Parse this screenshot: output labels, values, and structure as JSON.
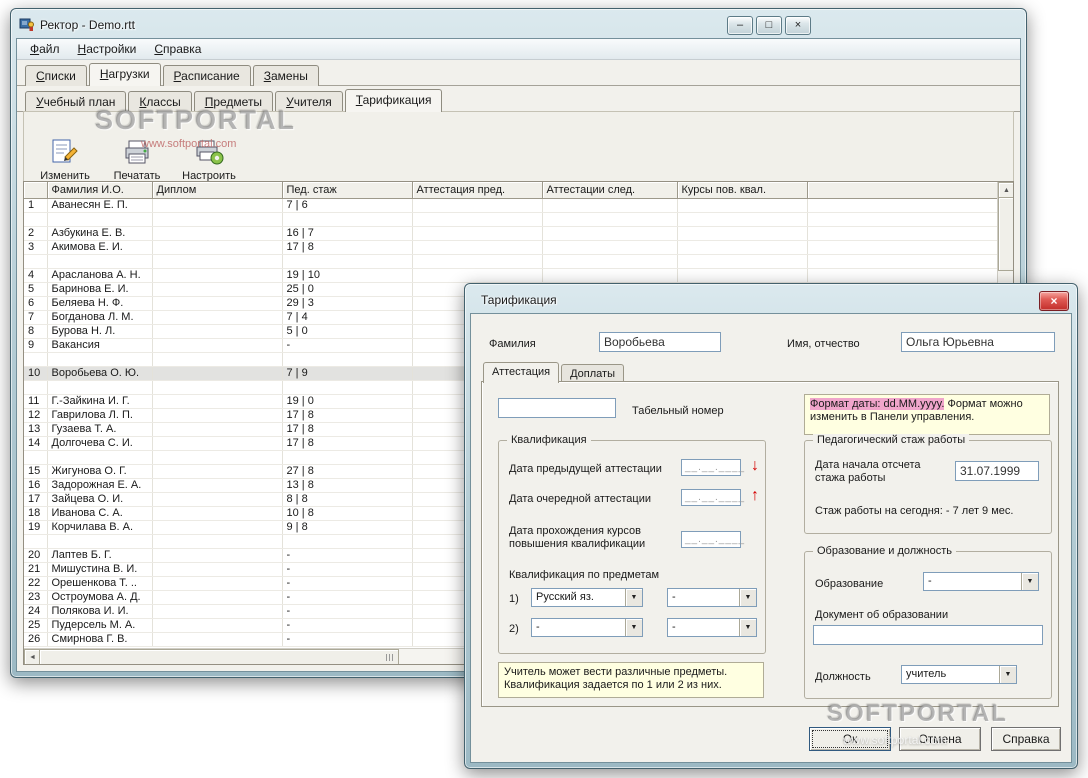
{
  "icons": {
    "minimize": "–",
    "maximize": "□",
    "close": "×",
    "arrow_up": "▲",
    "arrow_down": "▼",
    "arrow_left": "◄",
    "arrow_right": "►",
    "combo_arrow": "▼",
    "red_down_arrow": "↓",
    "red_up_arrow": "↑"
  },
  "main_window": {
    "title": "Ректор - Demo.rtt",
    "menu": [
      "Файл",
      "Настройки",
      "Справка"
    ],
    "main_tabs": {
      "items": [
        "Списки",
        "Нагрузки",
        "Расписание",
        "Замены"
      ],
      "active": 1
    },
    "sub_tabs": {
      "items": [
        "Учебный план",
        "Классы",
        "Предметы",
        "Учителя",
        "Тарификация"
      ],
      "active": 4
    },
    "toolbar": [
      {
        "id": "edit",
        "label": "Изменить"
      },
      {
        "id": "print",
        "label": "Печатать"
      },
      {
        "id": "configure",
        "label": "Настроить"
      }
    ],
    "watermark": {
      "big": "SOFTPORTAL",
      "small": "www.softportal.com"
    },
    "table": {
      "headers": [
        "Фамилия И.О.",
        "Диплом",
        "Пед. стаж",
        "Аттестация пред.",
        "Аттестации след.",
        "Курсы пов. квал."
      ],
      "rows": [
        {
          "n": "1",
          "name": "Аванесян Е. П.",
          "stazh": "7 | 6"
        },
        {
          "blank": true
        },
        {
          "n": "2",
          "name": "Азбукина Е. В.",
          "stazh": "16 | 7"
        },
        {
          "n": "3",
          "name": "Акимова Е. И.",
          "stazh": "17 | 8"
        },
        {
          "blank": true
        },
        {
          "n": "4",
          "name": "Арасланова А. Н.",
          "stazh": "19 | 10"
        },
        {
          "n": "5",
          "name": "Баринова Е. И.",
          "stazh": "25 | 0"
        },
        {
          "n": "6",
          "name": "Беляева Н. Ф.",
          "stazh": "29 | 3"
        },
        {
          "n": "7",
          "name": "Богданова Л. М.",
          "stazh": "7 | 4"
        },
        {
          "n": "8",
          "name": "Бурова Н. Л.",
          "stazh": "5 | 0"
        },
        {
          "n": "9",
          "name": "Вакансия",
          "stazh": "-"
        },
        {
          "blank": true
        },
        {
          "n": "10",
          "name": "Воробьева О. Ю.",
          "stazh": "7 | 9",
          "selected": true
        },
        {
          "blank": true
        },
        {
          "n": "11",
          "name": "Г.-Зайкина И. Г.",
          "stazh": "19 | 0"
        },
        {
          "n": "12",
          "name": "Гаврилова Л. П.",
          "stazh": "17 | 8"
        },
        {
          "n": "13",
          "name": "Гузаева Т. А.",
          "stazh": "17 | 8"
        },
        {
          "n": "14",
          "name": "Долгочева С. И.",
          "stazh": "17 | 8"
        },
        {
          "blank": true
        },
        {
          "n": "15",
          "name": "Жигунова О. Г.",
          "stazh": "27 | 8"
        },
        {
          "n": "16",
          "name": "Задорожная Е. А.",
          "stazh": "13 | 8"
        },
        {
          "n": "17",
          "name": "Зайцева О. И.",
          "stazh": "8 | 8"
        },
        {
          "n": "18",
          "name": "Иванова С. А.",
          "stazh": "10 | 8"
        },
        {
          "n": "19",
          "name": "Корчилава В. А.",
          "stazh": "9 | 8"
        },
        {
          "blank": true
        },
        {
          "n": "20",
          "name": "Лаптев Б. Г.",
          "stazh": "-"
        },
        {
          "n": "21",
          "name": "Мишустина В. И.",
          "stazh": "-"
        },
        {
          "n": "22",
          "name": "Орешенкова Т. ..",
          "stazh": "-"
        },
        {
          "n": "23",
          "name": "Остроумова А. Д.",
          "stazh": "-"
        },
        {
          "n": "24",
          "name": "Полякова И. И.",
          "stazh": "-"
        },
        {
          "n": "25",
          "name": "Пудерсель М. А.",
          "stazh": "-"
        },
        {
          "n": "26",
          "name": "Смирнова Г. В.",
          "stazh": "-"
        }
      ]
    }
  },
  "dialog": {
    "title": "Тарификация",
    "surname_label": "Фамилия",
    "surname_value": "Воробьева",
    "name_label": "Имя, отчество",
    "name_value": "Ольга Юрьевна",
    "tabs": {
      "items": [
        "Аттестация",
        "Доплаты"
      ],
      "active": 0
    },
    "tab_number_label": "Табельный номер",
    "tab_number_value": "",
    "date_mask": "__.__.____",
    "note_format_highlight": "Формат даты: dd.MM.yyyy.",
    "note_format_rest": " Формат можно изменить в Панели управления.",
    "qual_group": {
      "legend": "Квалификация",
      "prev_att_label": "Дата предыдущей аттестации",
      "next_att_label": "Дата очередной аттестации",
      "courses_label": "Дата прохождения курсов повышения квалификации",
      "subjects_label": "Квалификация по предметам",
      "row1_num": "1)",
      "row1_subject": "Русский яз.",
      "row1_grade": "-",
      "row2_num": "2)",
      "row2_subject": "-",
      "row2_grade": "-"
    },
    "note_subjects": "Учитель может вести различные предметы. Квалификация задается по 1 или 2 из них.",
    "stazh_group": {
      "legend": "Педагогический стаж работы",
      "start_label": "Дата начала отсчета стажа работы",
      "start_value": "31.07.1999",
      "today_text": "Стаж работы на сегодня: - 7 лет 9 мес."
    },
    "edu_group": {
      "legend": "Образование и должность",
      "education_label": "Образование",
      "education_value": "-",
      "document_label": "Документ об образовании",
      "document_value": "",
      "position_label": "Должность",
      "position_value": "учитель"
    },
    "buttons": {
      "ok": "Ок",
      "cancel": "Отмена",
      "help": "Справка"
    },
    "watermark": {
      "big": "SOFTPORTAL",
      "small": "www.softportal.com"
    }
  }
}
